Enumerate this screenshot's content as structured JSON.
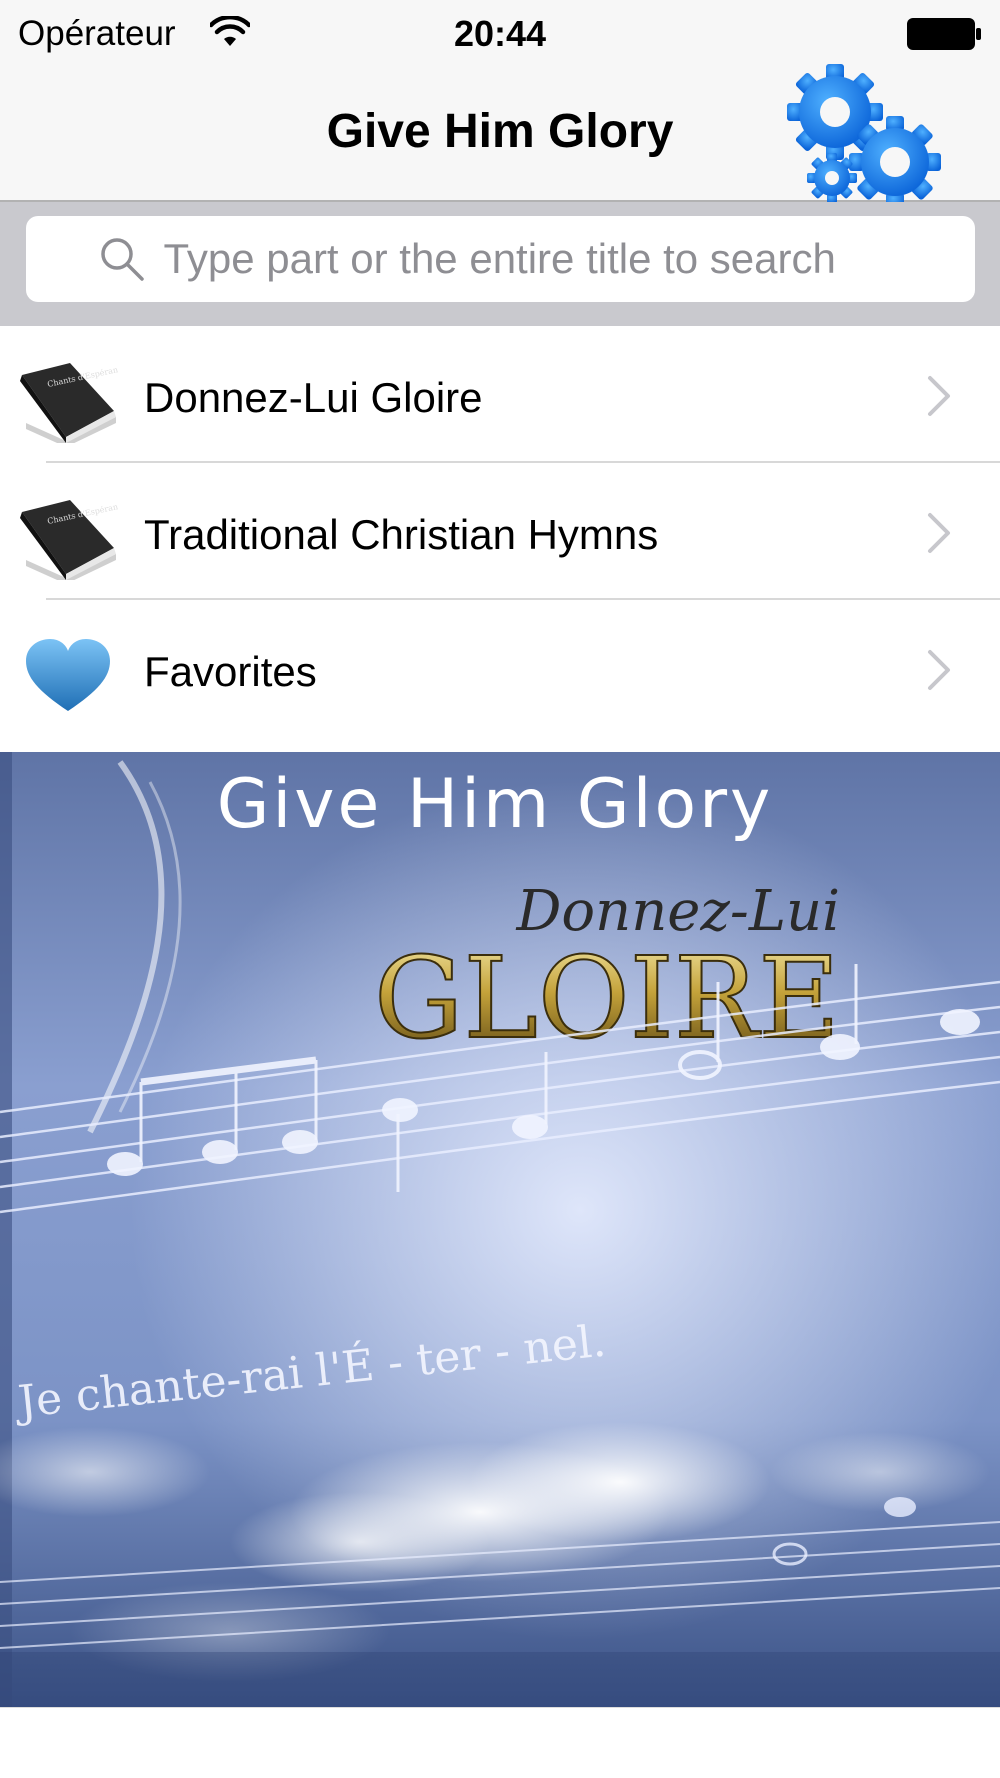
{
  "status_bar": {
    "carrier": "Opérateur",
    "time": "20:44"
  },
  "nav": {
    "title": "Give Him Glory",
    "settings_icon": "gears-icon"
  },
  "search": {
    "placeholder": "Type part or the entire title to search",
    "value": ""
  },
  "list": {
    "items": [
      {
        "label": "Donnez-Lui Gloire",
        "icon": "hymnbook-icon",
        "book_cover_text": "Chants d'Espérance"
      },
      {
        "label": "Traditional Christian Hymns",
        "icon": "hymnbook-icon",
        "book_cover_text": "Chants d'Espérance"
      },
      {
        "label": "Favorites",
        "icon": "heart-icon"
      }
    ]
  },
  "banner": {
    "title": "Give Him Glory",
    "subtitle": "Donnez-Lui",
    "big_title": "GLOIRE",
    "lyric_line": "Je chante-rai l'É - ter - nel."
  },
  "colors": {
    "accent_blue": "#1a7de2",
    "heart_blue": "#3e93d6",
    "banner_blue": "#6f86b8"
  }
}
